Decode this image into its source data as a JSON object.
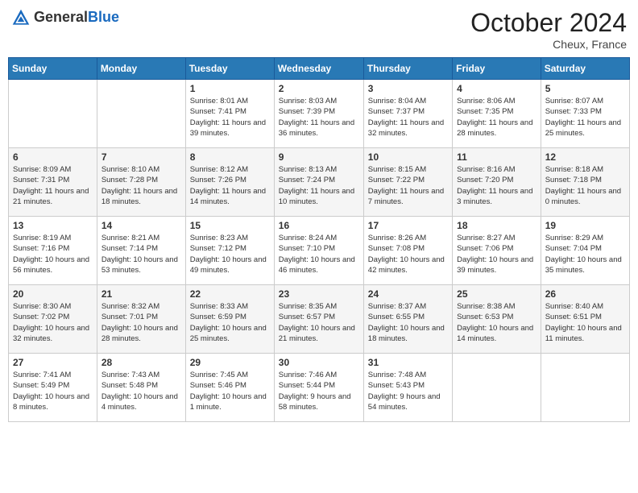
{
  "header": {
    "logo_general": "General",
    "logo_blue": "Blue",
    "month_title": "October 2024",
    "location": "Cheux, France"
  },
  "weekdays": [
    "Sunday",
    "Monday",
    "Tuesday",
    "Wednesday",
    "Thursday",
    "Friday",
    "Saturday"
  ],
  "weeks": [
    [
      {
        "day": "",
        "sunrise": "",
        "sunset": "",
        "daylight": ""
      },
      {
        "day": "",
        "sunrise": "",
        "sunset": "",
        "daylight": ""
      },
      {
        "day": "1",
        "sunrise": "Sunrise: 8:01 AM",
        "sunset": "Sunset: 7:41 PM",
        "daylight": "Daylight: 11 hours and 39 minutes."
      },
      {
        "day": "2",
        "sunrise": "Sunrise: 8:03 AM",
        "sunset": "Sunset: 7:39 PM",
        "daylight": "Daylight: 11 hours and 36 minutes."
      },
      {
        "day": "3",
        "sunrise": "Sunrise: 8:04 AM",
        "sunset": "Sunset: 7:37 PM",
        "daylight": "Daylight: 11 hours and 32 minutes."
      },
      {
        "day": "4",
        "sunrise": "Sunrise: 8:06 AM",
        "sunset": "Sunset: 7:35 PM",
        "daylight": "Daylight: 11 hours and 28 minutes."
      },
      {
        "day": "5",
        "sunrise": "Sunrise: 8:07 AM",
        "sunset": "Sunset: 7:33 PM",
        "daylight": "Daylight: 11 hours and 25 minutes."
      }
    ],
    [
      {
        "day": "6",
        "sunrise": "Sunrise: 8:09 AM",
        "sunset": "Sunset: 7:31 PM",
        "daylight": "Daylight: 11 hours and 21 minutes."
      },
      {
        "day": "7",
        "sunrise": "Sunrise: 8:10 AM",
        "sunset": "Sunset: 7:28 PM",
        "daylight": "Daylight: 11 hours and 18 minutes."
      },
      {
        "day": "8",
        "sunrise": "Sunrise: 8:12 AM",
        "sunset": "Sunset: 7:26 PM",
        "daylight": "Daylight: 11 hours and 14 minutes."
      },
      {
        "day": "9",
        "sunrise": "Sunrise: 8:13 AM",
        "sunset": "Sunset: 7:24 PM",
        "daylight": "Daylight: 11 hours and 10 minutes."
      },
      {
        "day": "10",
        "sunrise": "Sunrise: 8:15 AM",
        "sunset": "Sunset: 7:22 PM",
        "daylight": "Daylight: 11 hours and 7 minutes."
      },
      {
        "day": "11",
        "sunrise": "Sunrise: 8:16 AM",
        "sunset": "Sunset: 7:20 PM",
        "daylight": "Daylight: 11 hours and 3 minutes."
      },
      {
        "day": "12",
        "sunrise": "Sunrise: 8:18 AM",
        "sunset": "Sunset: 7:18 PM",
        "daylight": "Daylight: 11 hours and 0 minutes."
      }
    ],
    [
      {
        "day": "13",
        "sunrise": "Sunrise: 8:19 AM",
        "sunset": "Sunset: 7:16 PM",
        "daylight": "Daylight: 10 hours and 56 minutes."
      },
      {
        "day": "14",
        "sunrise": "Sunrise: 8:21 AM",
        "sunset": "Sunset: 7:14 PM",
        "daylight": "Daylight: 10 hours and 53 minutes."
      },
      {
        "day": "15",
        "sunrise": "Sunrise: 8:23 AM",
        "sunset": "Sunset: 7:12 PM",
        "daylight": "Daylight: 10 hours and 49 minutes."
      },
      {
        "day": "16",
        "sunrise": "Sunrise: 8:24 AM",
        "sunset": "Sunset: 7:10 PM",
        "daylight": "Daylight: 10 hours and 46 minutes."
      },
      {
        "day": "17",
        "sunrise": "Sunrise: 8:26 AM",
        "sunset": "Sunset: 7:08 PM",
        "daylight": "Daylight: 10 hours and 42 minutes."
      },
      {
        "day": "18",
        "sunrise": "Sunrise: 8:27 AM",
        "sunset": "Sunset: 7:06 PM",
        "daylight": "Daylight: 10 hours and 39 minutes."
      },
      {
        "day": "19",
        "sunrise": "Sunrise: 8:29 AM",
        "sunset": "Sunset: 7:04 PM",
        "daylight": "Daylight: 10 hours and 35 minutes."
      }
    ],
    [
      {
        "day": "20",
        "sunrise": "Sunrise: 8:30 AM",
        "sunset": "Sunset: 7:02 PM",
        "daylight": "Daylight: 10 hours and 32 minutes."
      },
      {
        "day": "21",
        "sunrise": "Sunrise: 8:32 AM",
        "sunset": "Sunset: 7:01 PM",
        "daylight": "Daylight: 10 hours and 28 minutes."
      },
      {
        "day": "22",
        "sunrise": "Sunrise: 8:33 AM",
        "sunset": "Sunset: 6:59 PM",
        "daylight": "Daylight: 10 hours and 25 minutes."
      },
      {
        "day": "23",
        "sunrise": "Sunrise: 8:35 AM",
        "sunset": "Sunset: 6:57 PM",
        "daylight": "Daylight: 10 hours and 21 minutes."
      },
      {
        "day": "24",
        "sunrise": "Sunrise: 8:37 AM",
        "sunset": "Sunset: 6:55 PM",
        "daylight": "Daylight: 10 hours and 18 minutes."
      },
      {
        "day": "25",
        "sunrise": "Sunrise: 8:38 AM",
        "sunset": "Sunset: 6:53 PM",
        "daylight": "Daylight: 10 hours and 14 minutes."
      },
      {
        "day": "26",
        "sunrise": "Sunrise: 8:40 AM",
        "sunset": "Sunset: 6:51 PM",
        "daylight": "Daylight: 10 hours and 11 minutes."
      }
    ],
    [
      {
        "day": "27",
        "sunrise": "Sunrise: 7:41 AM",
        "sunset": "Sunset: 5:49 PM",
        "daylight": "Daylight: 10 hours and 8 minutes."
      },
      {
        "day": "28",
        "sunrise": "Sunrise: 7:43 AM",
        "sunset": "Sunset: 5:48 PM",
        "daylight": "Daylight: 10 hours and 4 minutes."
      },
      {
        "day": "29",
        "sunrise": "Sunrise: 7:45 AM",
        "sunset": "Sunset: 5:46 PM",
        "daylight": "Daylight: 10 hours and 1 minute."
      },
      {
        "day": "30",
        "sunrise": "Sunrise: 7:46 AM",
        "sunset": "Sunset: 5:44 PM",
        "daylight": "Daylight: 9 hours and 58 minutes."
      },
      {
        "day": "31",
        "sunrise": "Sunrise: 7:48 AM",
        "sunset": "Sunset: 5:43 PM",
        "daylight": "Daylight: 9 hours and 54 minutes."
      },
      {
        "day": "",
        "sunrise": "",
        "sunset": "",
        "daylight": ""
      },
      {
        "day": "",
        "sunrise": "",
        "sunset": "",
        "daylight": ""
      }
    ]
  ]
}
